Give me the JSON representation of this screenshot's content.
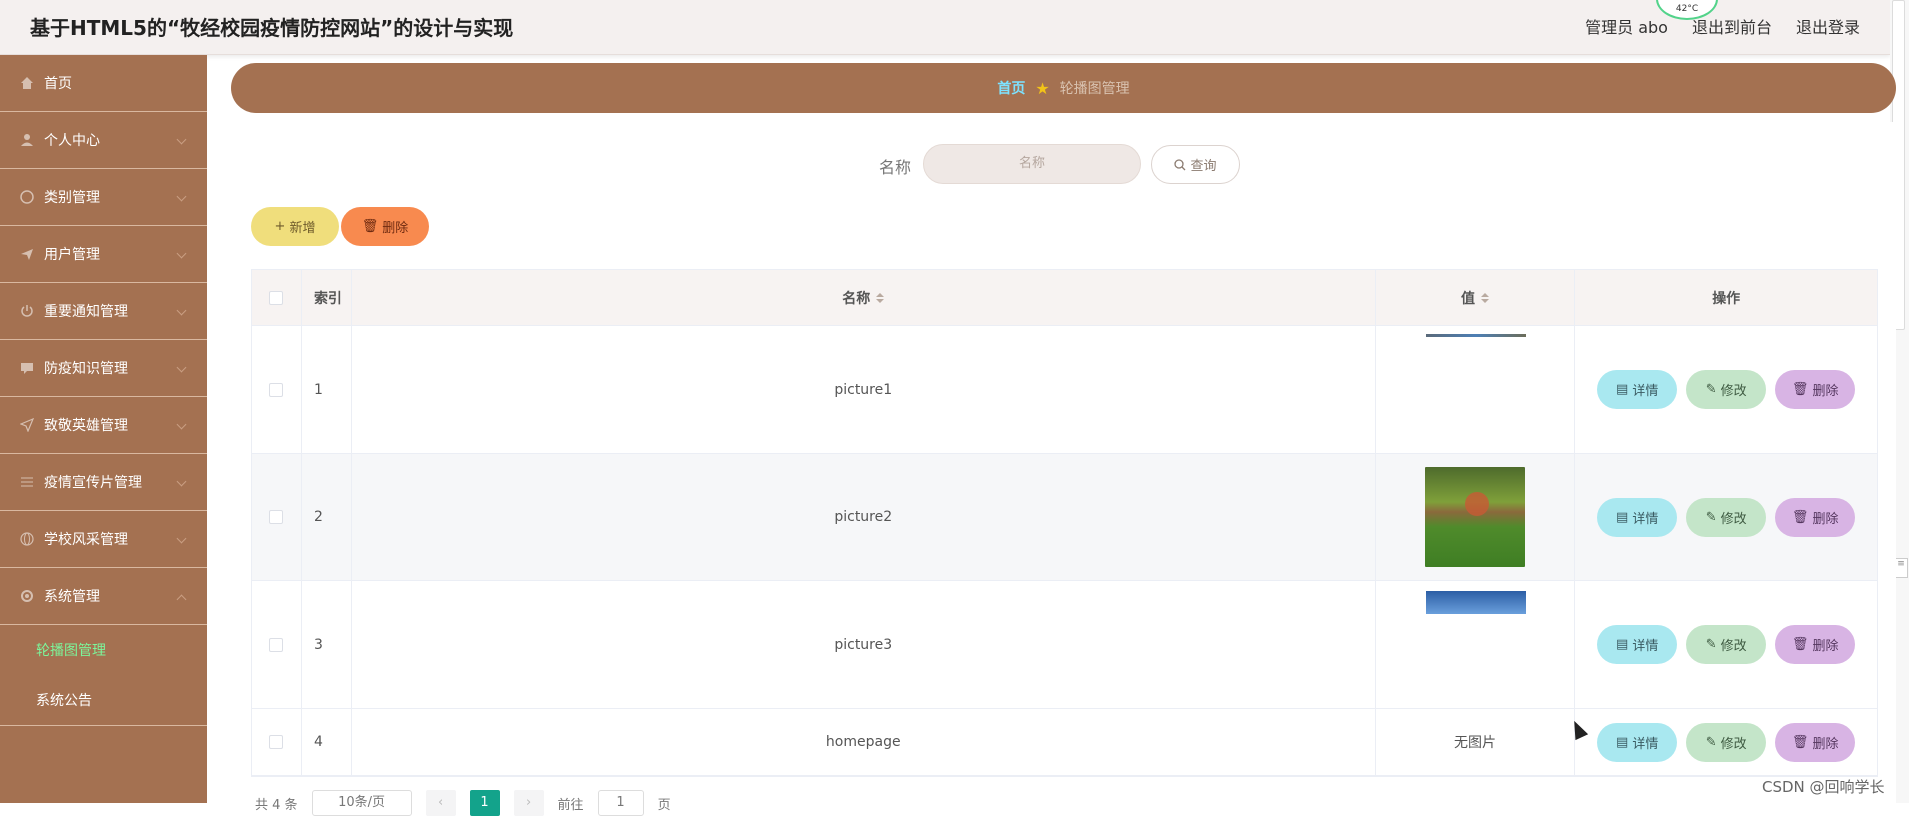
{
  "header": {
    "title": "基于HTML5的“牧经校园疫情防控网站”的设计与实现",
    "user_label": "管理员 abo",
    "front_label": "退出到前台",
    "logout_label": "退出登录",
    "weather_text": "42°C"
  },
  "sidebar": {
    "items": [
      {
        "label": "首页",
        "icon": "home-icon"
      },
      {
        "label": "个人中心",
        "icon": "user-icon"
      },
      {
        "label": "类别管理",
        "icon": "category-icon"
      },
      {
        "label": "用户管理",
        "icon": "plane-icon"
      },
      {
        "label": "重要通知管理",
        "icon": "power-icon"
      },
      {
        "label": "防疫知识管理",
        "icon": "book-icon"
      },
      {
        "label": "致敬英雄管理",
        "icon": "send-icon"
      },
      {
        "label": "疫情宣传片管理",
        "icon": "sliders-icon"
      },
      {
        "label": "学校风采管理",
        "icon": "globe-icon"
      },
      {
        "label": "系统管理",
        "icon": "gear-icon"
      }
    ],
    "sub_items": [
      {
        "label": "轮播图管理"
      },
      {
        "label": "系统公告"
      }
    ]
  },
  "breadcrumb": {
    "home": "首页",
    "current": "轮播图管理"
  },
  "search": {
    "label": "名称",
    "placeholder": "名称",
    "query_label": "查询"
  },
  "actions": {
    "add_label": "新增",
    "delete_label": "删除"
  },
  "table": {
    "columns": {
      "index": "索引",
      "name": "名称",
      "value": "值",
      "ops": "操作"
    },
    "rows": [
      {
        "index": "1",
        "name": "picture1",
        "value": ""
      },
      {
        "index": "2",
        "name": "picture2",
        "value": ""
      },
      {
        "index": "3",
        "name": "picture3",
        "value": ""
      },
      {
        "index": "4",
        "name": "homepage",
        "value": "无图片"
      }
    ],
    "ops": {
      "detail": "详情",
      "edit": "修改",
      "remove": "删除"
    }
  },
  "pagination": {
    "total": "共 4 条",
    "size": "10条/页",
    "current_page": "1",
    "goto_prefix": "前往",
    "goto_value": "1",
    "goto_suffix": "页"
  },
  "watermark": "CSDN @回响学长"
}
